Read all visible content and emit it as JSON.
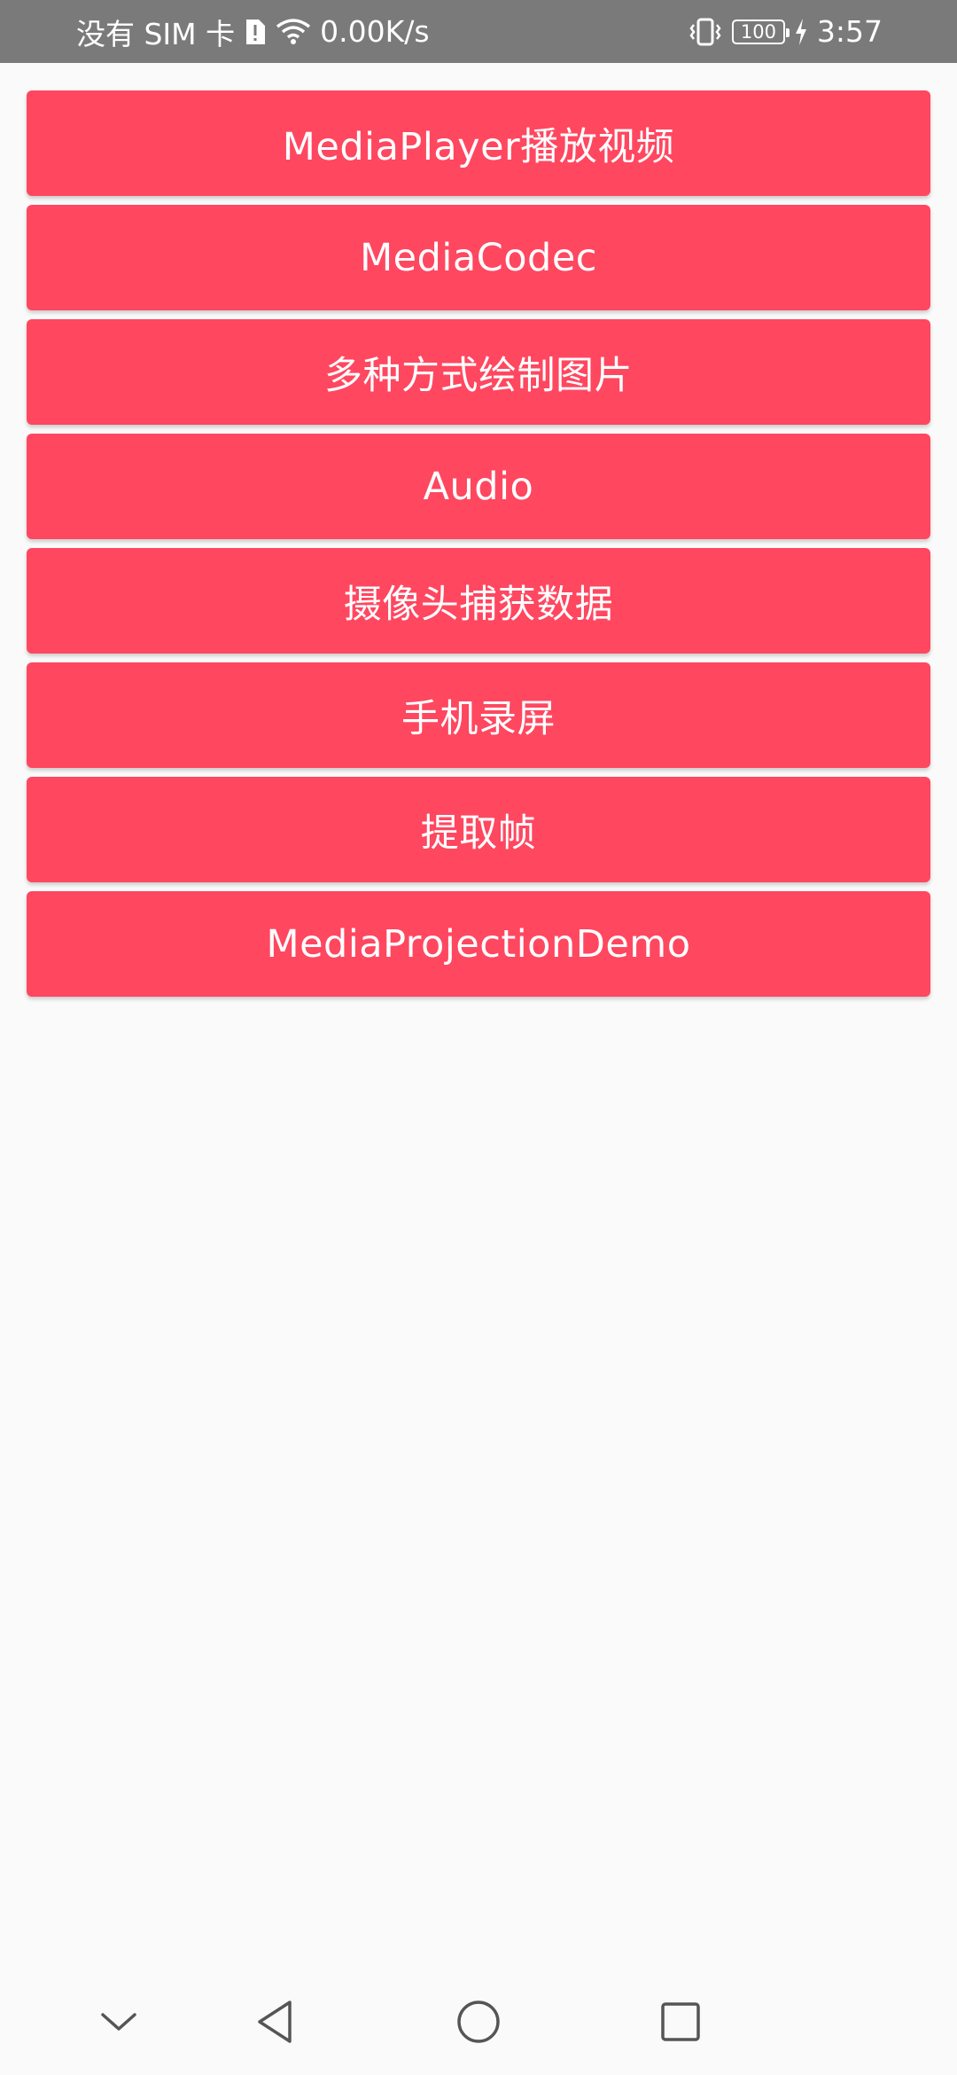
{
  "status_bar": {
    "carrier": "没有 SIM 卡",
    "speed": "0.00K/s",
    "battery": "100",
    "time": "3:57",
    "icons": [
      "sim-alert-icon",
      "wifi-icon",
      "vibrate-icon",
      "battery-icon",
      "charging-icon"
    ]
  },
  "buttons": [
    {
      "label": "MediaPlayer播放视频"
    },
    {
      "label": "MediaCodec"
    },
    {
      "label": "多种方式绘制图片"
    },
    {
      "label": "Audio"
    },
    {
      "label": "摄像头捕获数据"
    },
    {
      "label": "手机录屏"
    },
    {
      "label": "提取帧"
    },
    {
      "label": "MediaProjectionDemo"
    }
  ],
  "navigation": {
    "icons": [
      "hide-keyboard-icon",
      "back-icon",
      "home-icon",
      "recents-icon"
    ]
  },
  "colors": {
    "button": "#ff4760",
    "status_bar": "#7a7a7a",
    "background": "#fafafa"
  }
}
